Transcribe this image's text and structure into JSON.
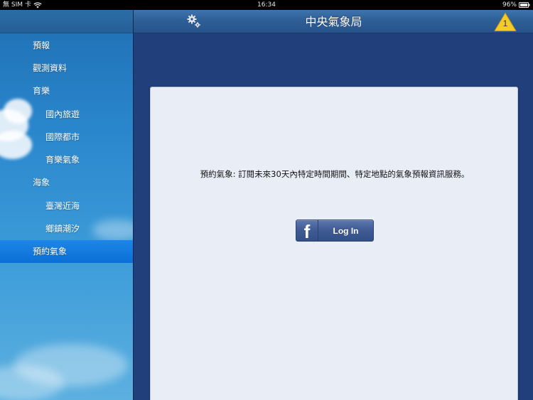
{
  "status_bar": {
    "carrier": "無 SIM 卡",
    "time": "16:34",
    "battery": "96%"
  },
  "nav": {
    "title": "中央氣象局",
    "alert_count": "1",
    "settings_icon": "gear-icon",
    "alert_icon": "warning-triangle-icon"
  },
  "sidebar": {
    "items": [
      {
        "label": "預報",
        "level": 0,
        "active": false
      },
      {
        "label": "觀測資料",
        "level": 0,
        "active": false
      },
      {
        "label": "育樂",
        "level": 0,
        "active": false
      },
      {
        "label": "國內旅遊",
        "level": 1,
        "active": false
      },
      {
        "label": "國際都市",
        "level": 1,
        "active": false
      },
      {
        "label": "育樂氣象",
        "level": 1,
        "active": false
      },
      {
        "label": "海象",
        "level": 0,
        "active": false
      },
      {
        "label": "臺灣近海",
        "level": 1,
        "active": false
      },
      {
        "label": "鄉鎮潮汐",
        "level": 1,
        "active": false
      },
      {
        "label": "預約氣象",
        "level": 0,
        "active": true
      }
    ]
  },
  "main": {
    "description": "預約氣象: 訂閱未來30天內特定時間期間、特定地點的氣象預報資訊服務。",
    "login_button": {
      "icon": "facebook-icon",
      "logo_text": "f",
      "label": "Log In"
    }
  },
  "colors": {
    "active_item": "#0a6fd6",
    "main_bg": "#213f7a",
    "facebook_blue": "#3f5b93"
  }
}
